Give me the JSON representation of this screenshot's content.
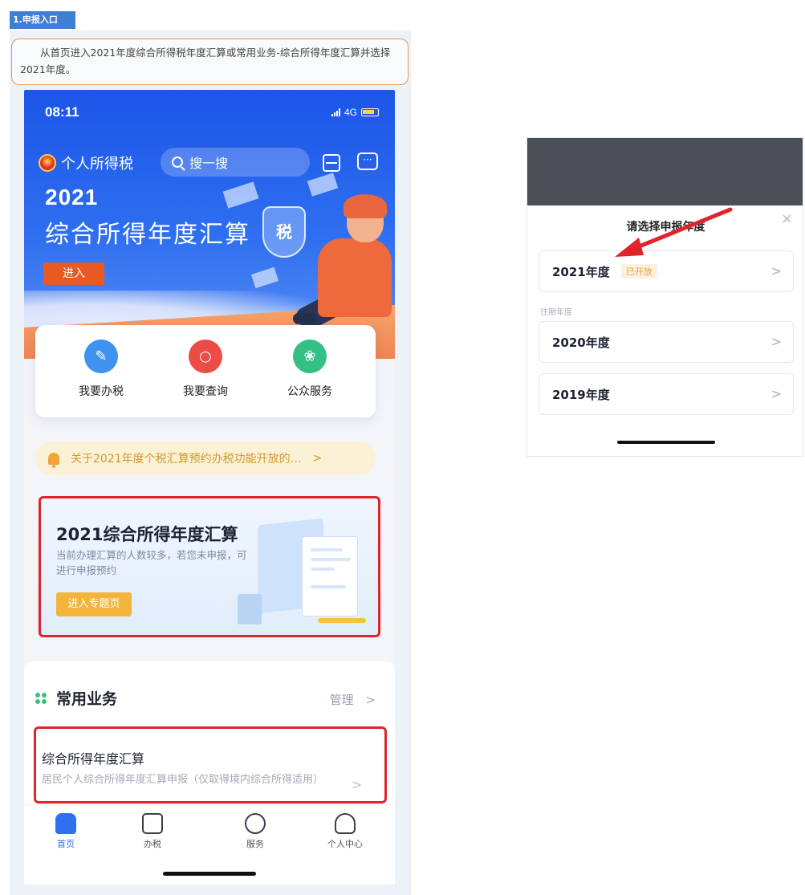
{
  "section_tag": "1.申报入口",
  "instruction": "从首页进入2021年度综合所得税年度汇算或常用业务-综合所得年度汇算并选择2021年度。",
  "phone": {
    "status": {
      "time": "08:11",
      "network": "4G"
    },
    "header": {
      "brand": "个人所得税",
      "search_placeholder": "搜一搜"
    },
    "banner": {
      "year": "2021",
      "title": "综合所得年度汇算",
      "shield_text": "税",
      "enter_label": "进入"
    },
    "quick_actions": [
      {
        "label": "我要办税",
        "icon": "pencil-icon",
        "color": "#3d93ef"
      },
      {
        "label": "我要查询",
        "icon": "magnifier-icon",
        "color": "#ec4c46"
      },
      {
        "label": "公众服务",
        "icon": "service-icon",
        "color": "#34bf84"
      }
    ],
    "notice": {
      "text": "关于2021年度个税汇算预约办税功能开放的…",
      "chevron": ">"
    },
    "annual_card": {
      "title": "2021综合所得年度汇算",
      "description": "当前办理汇算的人数较多，若您未申报，可进行申报预约",
      "button": "进入专题页"
    },
    "common": {
      "title": "常用业务",
      "manage": "管理",
      "manage_chevron": ">",
      "item_title": "综合所得年度汇算",
      "item_desc": "居民个人综合所得年度汇算申报（仅取得境内综合所得适用）",
      "item_chevron": ">"
    },
    "tabs": [
      {
        "label": "首页",
        "icon": "home-icon",
        "active": true
      },
      {
        "label": "办税",
        "icon": "document-icon",
        "active": false
      },
      {
        "label": "服务",
        "icon": "heart-service-icon",
        "active": false
      },
      {
        "label": "个人中心",
        "icon": "user-icon",
        "active": false
      }
    ]
  },
  "dialog": {
    "title": "请选择申报年度",
    "close": "×",
    "current": {
      "year": "2021年度",
      "tag": "已开放",
      "chevron": ">"
    },
    "past_label": "往期年度",
    "past": [
      {
        "year": "2020年度",
        "chevron": ">"
      },
      {
        "year": "2019年度",
        "chevron": ">"
      }
    ]
  },
  "colors": {
    "banner_blue": "#2f6ff0",
    "highlight_red": "#e0242b",
    "instruction_border": "#e09a55",
    "tag_blue": "#3e7fd1"
  }
}
